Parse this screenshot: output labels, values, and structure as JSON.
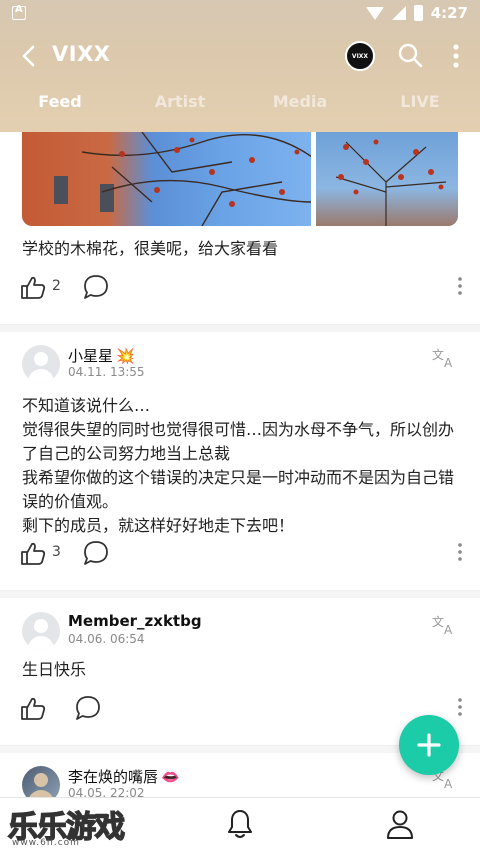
{
  "status_bar": {
    "time": "4:27"
  },
  "header": {
    "title": "VIXX",
    "avatar_label": "VIXX",
    "tabs": [
      {
        "label": "Feed",
        "active": true
      },
      {
        "label": "Artist",
        "active": false
      },
      {
        "label": "Media",
        "active": false
      },
      {
        "label": "LIVE",
        "active": false
      }
    ]
  },
  "posts": [
    {
      "text": "学校的木棉花，很美呢，给大家看看",
      "likes": "2"
    },
    {
      "username": "小星星",
      "username_emoji": "💥",
      "timestamp": "04.11. 13:55",
      "text": "不知道该说什么…\n觉得很失望的同时也觉得很可惜…因为水母不争气，所以创办了自己的公司努力地当上总裁\n我希望你做的这个错误的决定只是一时冲动而不是因为自己错误的价值观。\n剩下的成员，就这样好好地走下去吧！",
      "likes": "3"
    },
    {
      "username": "Member_zxktbg",
      "timestamp": "04.06. 06:54",
      "text": "生日快乐",
      "likes": ""
    },
    {
      "username": "李在焕的嘴唇",
      "username_emoji": "👄",
      "timestamp": "04.05. 22:02"
    }
  ],
  "watermark": {
    "text": "乐乐游戏",
    "url": "www.6ll.com"
  },
  "colors": {
    "accent": "#1ccba8",
    "header_bg": "#dcc9ad"
  }
}
